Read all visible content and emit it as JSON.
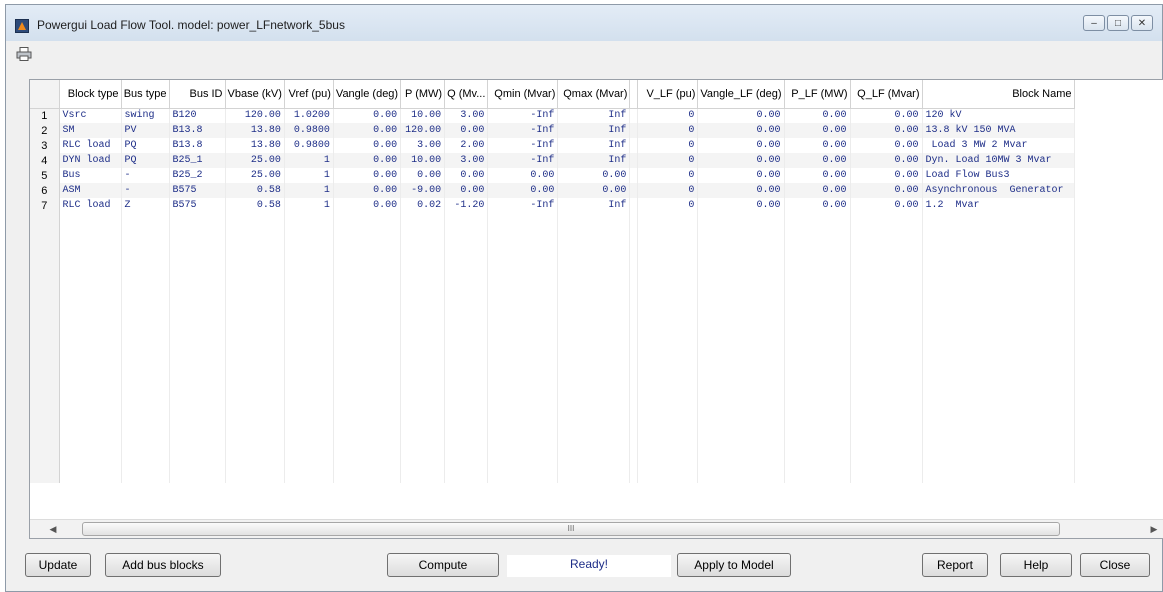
{
  "window": {
    "title": "Powergui Load Flow Tool. model: power_LFnetwork_5bus"
  },
  "columns": [
    "",
    "Block type",
    "Bus type",
    "Bus ID",
    "Vbase (kV)",
    "Vref (pu)",
    "Vangle (deg)",
    "P (MW)",
    "Q (Mv...",
    "Qmin (Mvar)",
    "Qmax (Mvar)",
    "",
    "V_LF (pu)",
    "Vangle_LF (deg)",
    "P_LF (MW)",
    "Q_LF (Mvar)",
    "Block Name"
  ],
  "rows": [
    [
      "1",
      "Vsrc",
      "swing",
      "B120",
      "120.00",
      "1.0200",
      "0.00",
      "10.00",
      "3.00",
      "-Inf",
      "Inf",
      "",
      "0",
      "0.00",
      "0.00",
      "0.00",
      "120 kV"
    ],
    [
      "2",
      "SM",
      "PV",
      "B13.8",
      "13.80",
      "0.9800",
      "0.00",
      "120.00",
      "0.00",
      "-Inf",
      "Inf",
      "",
      "0",
      "0.00",
      "0.00",
      "0.00",
      "13.8 kV 150 MVA"
    ],
    [
      "3",
      "RLC load",
      "PQ",
      "B13.8",
      "13.80",
      "0.9800",
      "0.00",
      "3.00",
      "2.00",
      "-Inf",
      "Inf",
      "",
      "0",
      "0.00",
      "0.00",
      "0.00",
      " Load 3 MW 2 Mvar"
    ],
    [
      "4",
      "DYN load",
      "PQ",
      "B25_1",
      "25.00",
      "1",
      "0.00",
      "10.00",
      "3.00",
      "-Inf",
      "Inf",
      "",
      "0",
      "0.00",
      "0.00",
      "0.00",
      "Dyn. Load 10MW 3 Mvar"
    ],
    [
      "5",
      "Bus",
      "-",
      "B25_2",
      "25.00",
      "1",
      "0.00",
      "0.00",
      "0.00",
      "0.00",
      "0.00",
      "",
      "0",
      "0.00",
      "0.00",
      "0.00",
      "Load Flow Bus3"
    ],
    [
      "6",
      "ASM",
      "-",
      "B575",
      "0.58",
      "1",
      "0.00",
      "-9.00",
      "0.00",
      "0.00",
      "0.00",
      "",
      "0",
      "0.00",
      "0.00",
      "0.00",
      "Asynchronous  Generator"
    ],
    [
      "7",
      "RLC load",
      "Z",
      "B575",
      "0.58",
      "1",
      "0.00",
      "0.02",
      "-1.20",
      "-Inf",
      "Inf",
      "",
      "0",
      "0.00",
      "0.00",
      "0.00",
      "1.2  Mvar"
    ]
  ],
  "scrollbar": {
    "grip": "III"
  },
  "buttons": {
    "update": "Update",
    "add_bus_blocks": "Add bus blocks",
    "compute": "Compute",
    "apply": "Apply to Model",
    "report": "Report",
    "help": "Help",
    "close": "Close"
  },
  "status": "Ready!"
}
